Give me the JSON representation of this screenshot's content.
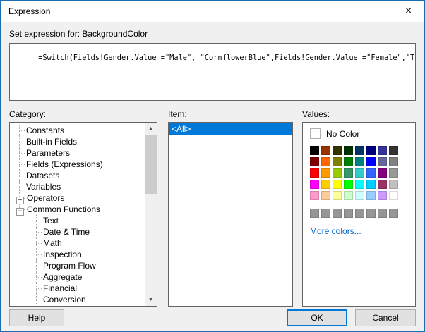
{
  "window": {
    "title": "Expression"
  },
  "icons": {
    "close": "×",
    "scroll_up": "▲",
    "scroll_down": "▼"
  },
  "colors": {
    "accent": "#0078d7",
    "selection": "#0078d7",
    "link": "#0066cc",
    "frame": "#1c6db0"
  },
  "expression": {
    "label": "Set expression for: BackgroundColor",
    "value": "=Switch(Fields!Gender.Value =\"Male\", \"CornflowerBlue\",Fields!Gender.Value =\"Female\",\"Tomato\")"
  },
  "category": {
    "label": "Category:",
    "items": [
      {
        "label": "Constants",
        "level": 1,
        "expander": ""
      },
      {
        "label": "Built-in Fields",
        "level": 1,
        "expander": ""
      },
      {
        "label": "Parameters",
        "level": 1,
        "expander": ""
      },
      {
        "label": "Fields (Expressions)",
        "level": 1,
        "expander": ""
      },
      {
        "label": "Datasets",
        "level": 1,
        "expander": ""
      },
      {
        "label": "Variables",
        "level": 1,
        "expander": ""
      },
      {
        "label": "Operators",
        "level": 0,
        "expander": "+"
      },
      {
        "label": "Common Functions",
        "level": 0,
        "expander": "−"
      },
      {
        "label": "Text",
        "level": 2,
        "expander": ""
      },
      {
        "label": "Date & Time",
        "level": 2,
        "expander": ""
      },
      {
        "label": "Math",
        "level": 2,
        "expander": ""
      },
      {
        "label": "Inspection",
        "level": 2,
        "expander": ""
      },
      {
        "label": "Program Flow",
        "level": 2,
        "expander": ""
      },
      {
        "label": "Aggregate",
        "level": 2,
        "expander": ""
      },
      {
        "label": "Financial",
        "level": 2,
        "expander": ""
      },
      {
        "label": "Conversion",
        "level": 2,
        "expander": ""
      }
    ]
  },
  "item": {
    "label": "Item:",
    "items": [
      {
        "label": "<All>",
        "selected": true
      }
    ]
  },
  "values": {
    "label": "Values:",
    "no_color_label": "No Color",
    "more_colors_label": "More colors...",
    "palette": [
      [
        "#000000",
        "#993300",
        "#333300",
        "#003300",
        "#003366",
        "#000080",
        "#333399",
        "#333333"
      ],
      [
        "#800000",
        "#FF6600",
        "#808000",
        "#008000",
        "#008080",
        "#0000FF",
        "#666699",
        "#808080"
      ],
      [
        "#FF0000",
        "#FF9900",
        "#99CC00",
        "#339966",
        "#33CCCC",
        "#3366FF",
        "#800080",
        "#999999"
      ],
      [
        "#FF00FF",
        "#FFCC00",
        "#FFFF00",
        "#00FF00",
        "#00FFFF",
        "#00CCFF",
        "#993366",
        "#C0C0C0"
      ],
      [
        "#FF99CC",
        "#FFCC99",
        "#FFFF99",
        "#CCFFCC",
        "#CCFFFF",
        "#99CCFF",
        "#CC99FF",
        "#FFFFFF"
      ]
    ],
    "gray_row": [
      "#969696",
      "#969696",
      "#969696",
      "#969696",
      "#969696",
      "#969696",
      "#969696",
      "#969696"
    ]
  },
  "buttons": {
    "help": "Help",
    "ok": "OK",
    "cancel": "Cancel"
  }
}
